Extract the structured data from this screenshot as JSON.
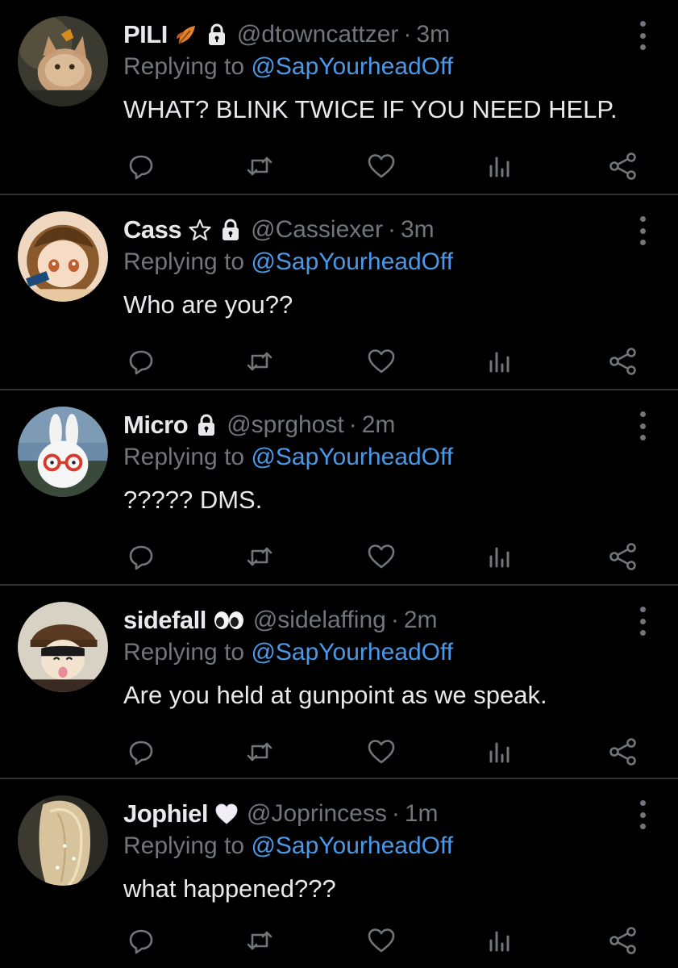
{
  "tweets": [
    {
      "name": "PILI",
      "badges": [
        "leaf-emoji-icon",
        "lock-icon"
      ],
      "handle": "@dtowncattzer",
      "dot": "·",
      "time": "3m",
      "reply_prefix": "Replying to ",
      "reply_to": "@SapYourheadOff",
      "text": "WHAT? BLINK TWICE IF YOU NEED HELP."
    },
    {
      "name": "Cass",
      "badges": [
        "star-outline-icon",
        "lock-icon"
      ],
      "handle": "@Cassiexer",
      "dot": "·",
      "time": "3m",
      "reply_prefix": "Replying to ",
      "reply_to": "@SapYourheadOff",
      "text": "Who are you??"
    },
    {
      "name": "Micro",
      "badges": [
        "lock-icon"
      ],
      "handle": "@sprghost",
      "dot": "·",
      "time": "2m",
      "reply_prefix": "Replying to ",
      "reply_to": "@SapYourheadOff",
      "text": "????? DMS."
    },
    {
      "name": "sidefall",
      "badges": [
        "eyes-emoji-icon"
      ],
      "handle": "@sidelaffing",
      "dot": "·",
      "time": "2m",
      "reply_prefix": "Replying to ",
      "reply_to": "@SapYourheadOff",
      "text": "Are you held at gunpoint as we speak."
    },
    {
      "name": "Jophiel",
      "badges": [
        "white-heart-emoji-icon"
      ],
      "handle": "@Joprincess",
      "dot": "·",
      "time": "1m",
      "reply_prefix": "Replying to ",
      "reply_to": "@SapYourheadOff",
      "text": "what happened???"
    }
  ],
  "actions": [
    "reply-icon",
    "retweet-icon",
    "like-icon",
    "views-icon",
    "share-icon"
  ],
  "colors": {
    "background": "#000000",
    "primary_text": "#e7e9ea",
    "secondary_text": "#71767b",
    "mention": "#4a99e9",
    "divider": "#2f3336"
  }
}
